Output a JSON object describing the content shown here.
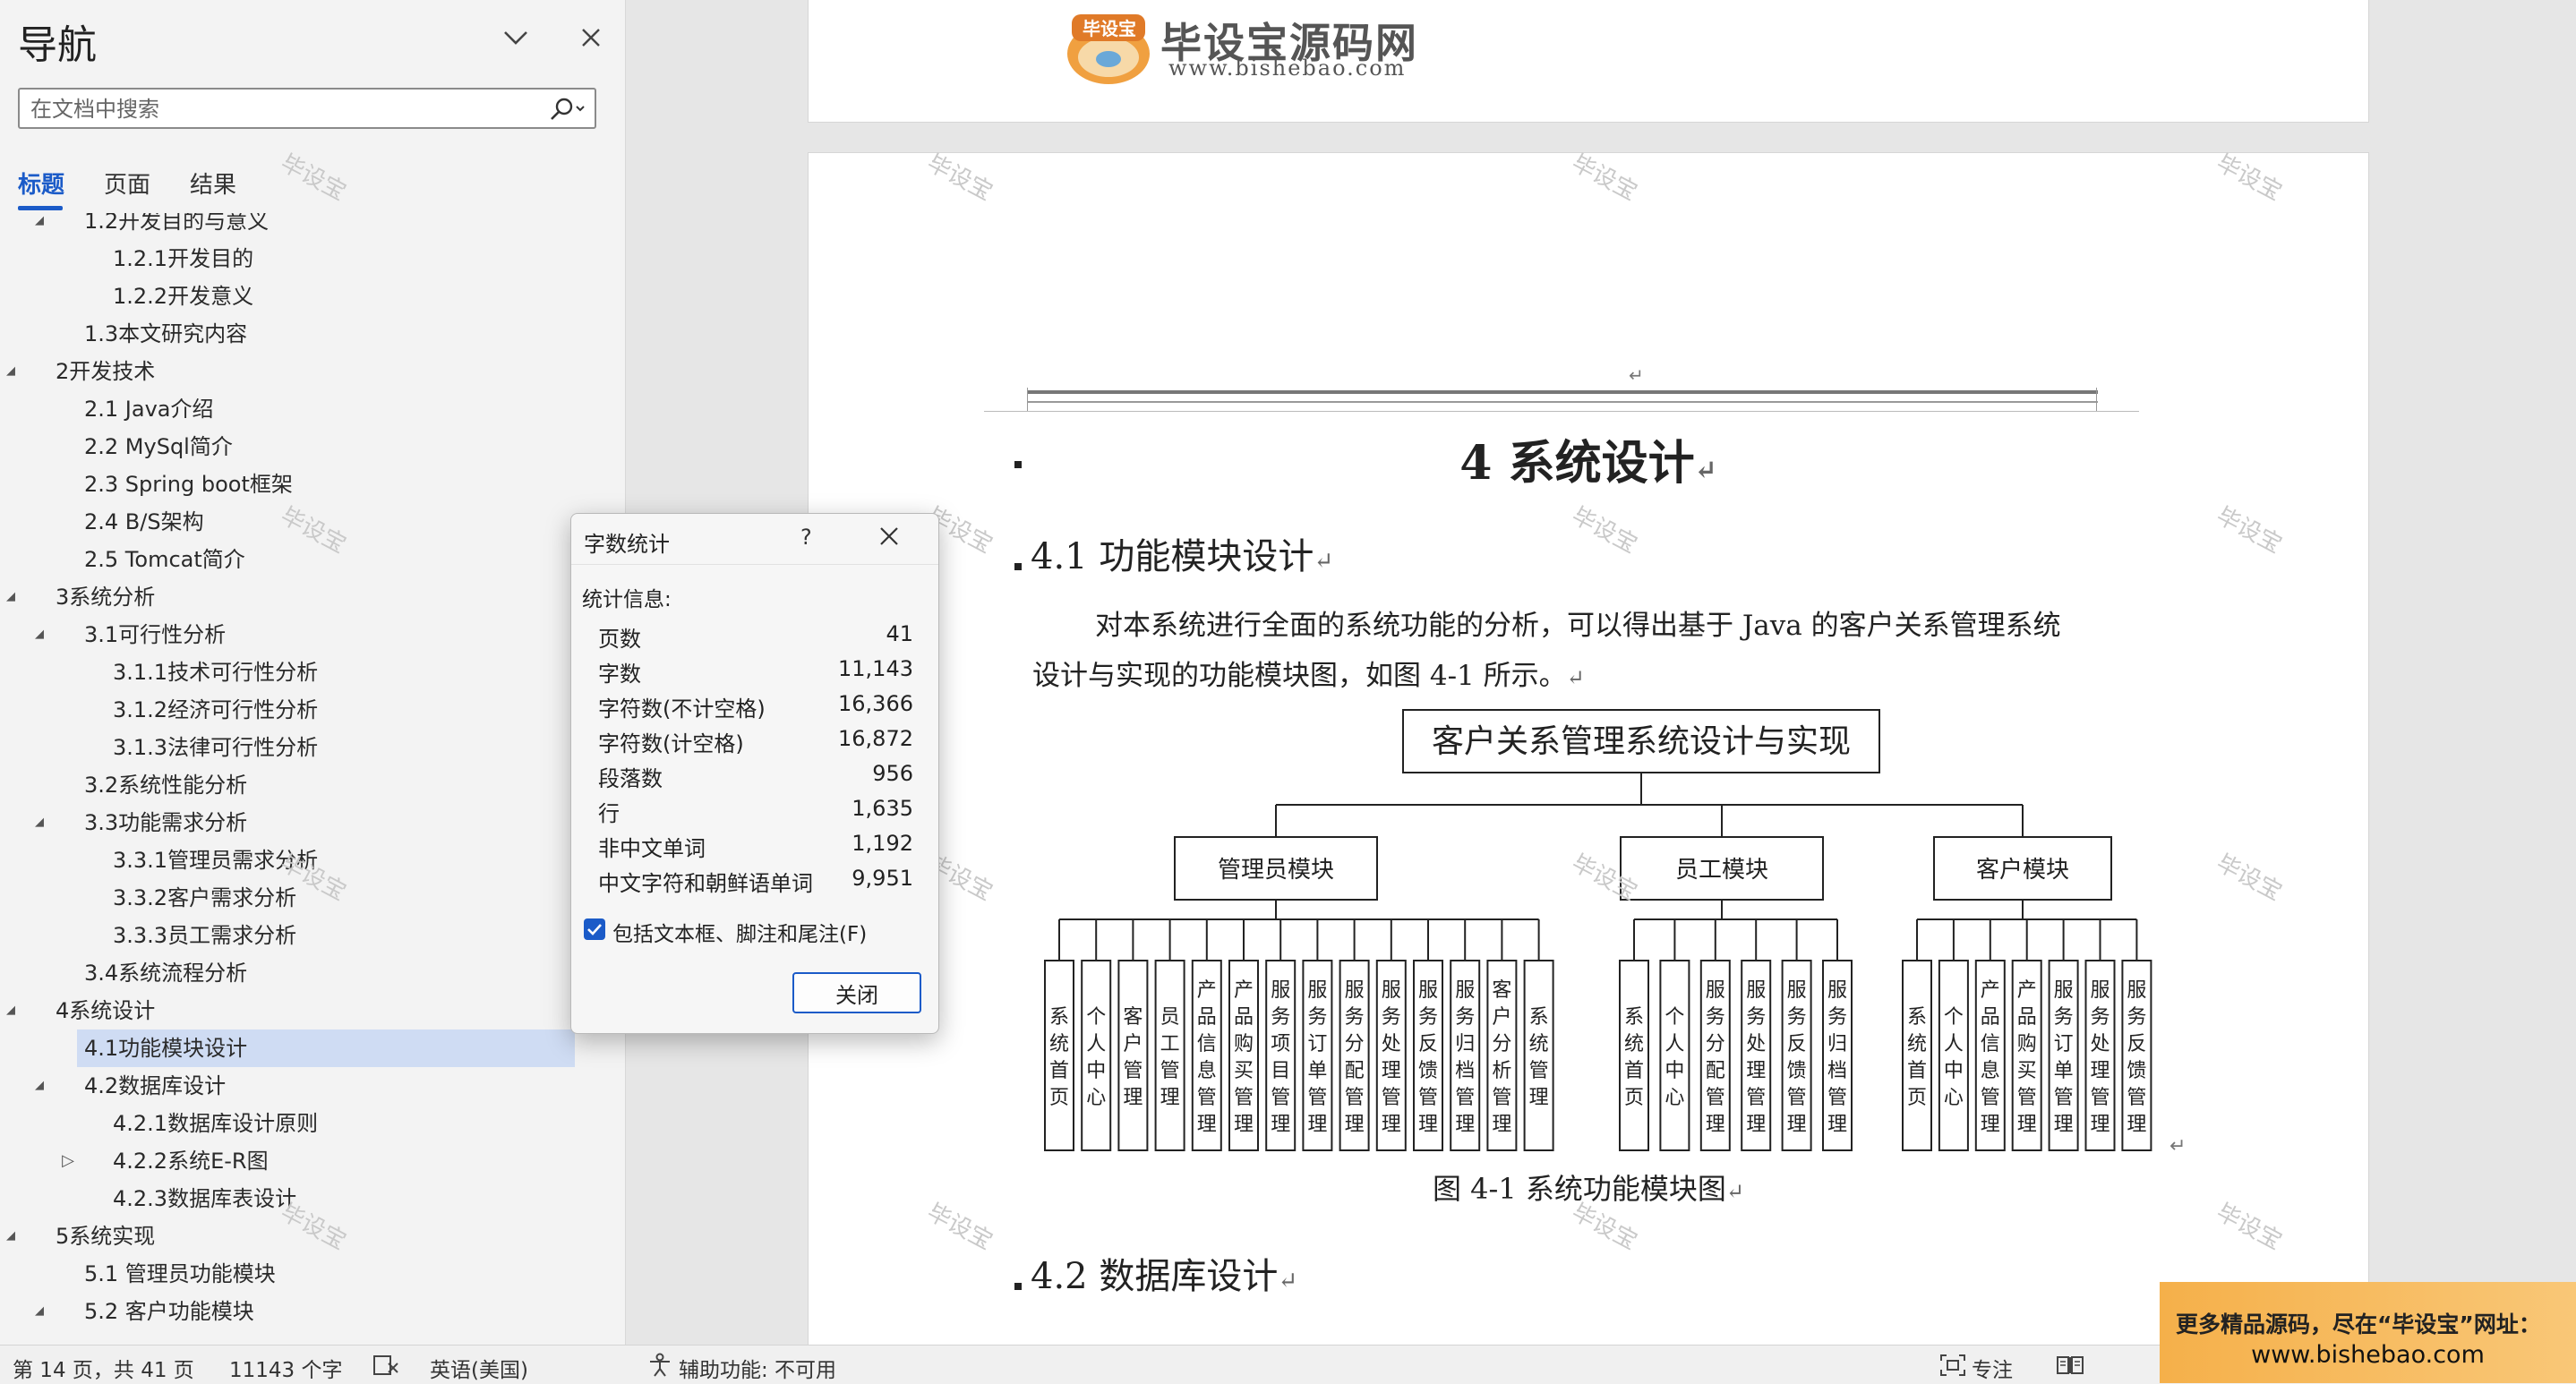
{
  "nav": {
    "title": "导航",
    "search_placeholder": "在文档中搜索",
    "tabs": [
      "标题",
      "页面",
      "结果"
    ],
    "tree": [
      {
        "text": "1.2开发目的与意义",
        "level": 2,
        "twisty": "expanded",
        "partial": true
      },
      {
        "text": "1.2.1开发目的",
        "level": 3
      },
      {
        "text": "1.2.2开发意义",
        "level": 3
      },
      {
        "text": "1.3本文研究内容",
        "level": 2
      },
      {
        "text": "2开发技术",
        "level": 1,
        "twisty": "expanded"
      },
      {
        "text": "2.1 Java介绍",
        "level": 2
      },
      {
        "text": "2.2 MySql简介",
        "level": 2
      },
      {
        "text": "2.3 Spring boot框架",
        "level": 2
      },
      {
        "text": "2.4 B/S架构",
        "level": 2
      },
      {
        "text": "2.5 Tomcat简介",
        "level": 2
      },
      {
        "text": "3系统分析",
        "level": 1,
        "twisty": "expanded"
      },
      {
        "text": "3.1可行性分析",
        "level": 2,
        "twisty": "expanded"
      },
      {
        "text": "3.1.1技术可行性分析",
        "level": 3
      },
      {
        "text": "3.1.2经济可行性分析",
        "level": 3
      },
      {
        "text": "3.1.3法律可行性分析",
        "level": 3
      },
      {
        "text": "3.2系统性能分析",
        "level": 2
      },
      {
        "text": "3.3功能需求分析",
        "level": 2,
        "twisty": "expanded"
      },
      {
        "text": "3.3.1管理员需求分析",
        "level": 3
      },
      {
        "text": "3.3.2客户需求分析",
        "level": 3
      },
      {
        "text": "3.3.3员工需求分析",
        "level": 3
      },
      {
        "text": "3.4系统流程分析",
        "level": 2
      },
      {
        "text": "4系统设计",
        "level": 1,
        "twisty": "expanded"
      },
      {
        "text": "4.1功能模块设计",
        "level": 2,
        "selected": true
      },
      {
        "text": "4.2数据库设计",
        "level": 2,
        "twisty": "expanded"
      },
      {
        "text": "4.2.1数据库设计原则",
        "level": 3
      },
      {
        "text": "4.2.2系统E-R图",
        "level": 3,
        "twisty": "collapsed"
      },
      {
        "text": "4.2.3数据库表设计",
        "level": 3
      },
      {
        "text": "5系统实现",
        "level": 1,
        "twisty": "expanded"
      },
      {
        "text": "5.1  管理员功能模块",
        "level": 2
      },
      {
        "text": "5.2 客户功能模块",
        "level": 2,
        "twisty": "expanded"
      }
    ]
  },
  "logo": {
    "cn": "毕设宝源码网",
    "url": "www.bishebao.com",
    "badge": "毕设宝"
  },
  "watermark": "毕设宝",
  "doc": {
    "chapter": "4 系统设计",
    "section1": "4.1 功能模块设计",
    "para_line1": "对本系统进行全面的系统功能的分析，可以得出基于 Java 的客户关系管理系统",
    "para_line2": "设计与实现的功能模块图，如图 4-1 所示。",
    "caption": "图 4-1  系统功能模块图",
    "section2": "4.2 数据库设计",
    "return_mark": "↵"
  },
  "diagram": {
    "root": "客户关系管理系统设计与实现",
    "modules": [
      {
        "name": "管理员模块",
        "leaves": [
          "系统首页",
          "个人中心",
          "客户管理",
          "员工管理",
          "产品信息管理",
          "产品购买管理",
          "服务项目管理",
          "服务订单管理",
          "服务分配管理",
          "服务处理管理",
          "服务反馈管理",
          "服务归档管理",
          "客户分析管理",
          "系统管理"
        ]
      },
      {
        "name": "员工模块",
        "leaves": [
          "系统首页",
          "个人中心",
          "服务分配管理",
          "服务处理管理",
          "服务反馈管理",
          "服务归档管理"
        ]
      },
      {
        "name": "客户模块",
        "leaves": [
          "系统首页",
          "个人中心",
          "产品信息管理",
          "产品购买管理",
          "服务订单管理",
          "服务处理管理",
          "服务反馈管理"
        ]
      }
    ]
  },
  "dialog": {
    "title": "字数统计",
    "help": "?",
    "section": "统计信息:",
    "stats": [
      {
        "label": "页数",
        "value": "41"
      },
      {
        "label": "字数",
        "value": "11,143"
      },
      {
        "label": "字符数(不计空格)",
        "value": "16,366"
      },
      {
        "label": "字符数(计空格)",
        "value": "16,872"
      },
      {
        "label": "段落数",
        "value": "956"
      },
      {
        "label": "行",
        "value": "1,635"
      },
      {
        "label": "非中文单词",
        "value": "1,192"
      },
      {
        "label": "中文字符和朝鲜语单词",
        "value": "9,951"
      }
    ],
    "checkbox_label": "包括文本框、脚注和尾注(F)",
    "checkbox_checked": true,
    "close_label": "关闭"
  },
  "status": {
    "page": "第 14 页，共 41 页",
    "words": "11143 个字",
    "language": "英语(美国)",
    "accessibility": "辅助功能: 不可用",
    "focus": "专注"
  },
  "promo": {
    "line1": "更多精品源码，尽在“毕设宝”网址：",
    "line2": "www.bishebao.com"
  },
  "colors": {
    "accent": "#1b5bc8",
    "selected_row": "#cfdcf3",
    "promo": "#f5b04a"
  }
}
